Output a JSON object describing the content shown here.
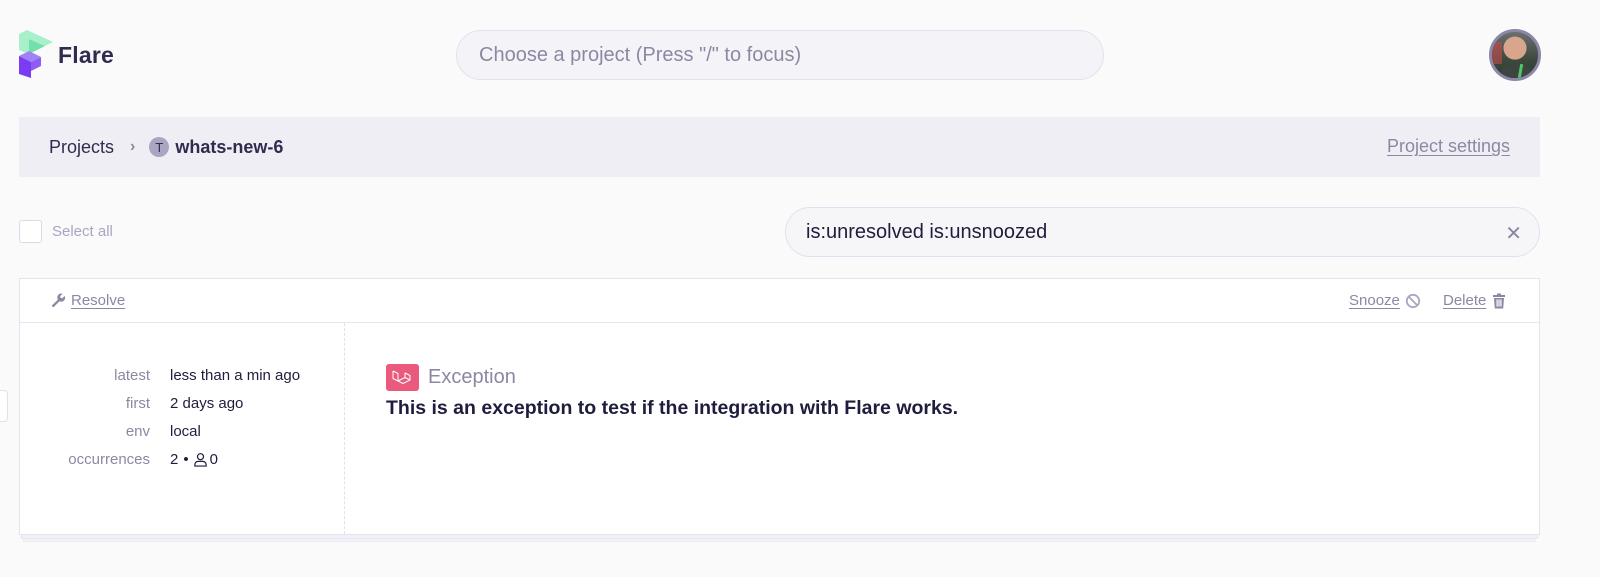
{
  "app": {
    "name": "Flare",
    "brand_colors": {
      "logo_green": "#a6f0cc",
      "logo_purple": "#8e5cf5",
      "error_badge": "#ea5a7d"
    }
  },
  "header": {
    "project_search_placeholder": "Choose a project (Press \"/\" to focus)",
    "avatar_icon": "user-avatar-photo"
  },
  "breadcrumb": {
    "root_label": "Projects",
    "separator_icon": "chevron-right-icon",
    "separator_glyph": "›",
    "project_badge_letter": "T",
    "current_project": "whats-new-6",
    "settings_link": "Project settings"
  },
  "filters": {
    "select_all_label": "Select all",
    "query_value": "is:unresolved is:unsnoozed",
    "clear_glyph": "✕"
  },
  "actions": {
    "resolve_label": "Resolve",
    "snooze_label": "Snooze",
    "delete_label": "Delete"
  },
  "errors": [
    {
      "meta": [
        {
          "key": "latest",
          "value": "less than a min ago"
        },
        {
          "key": "first",
          "value": "2 days ago"
        },
        {
          "key": "env",
          "value": "local"
        }
      ],
      "occurrences_label": "occurrences",
      "occurrences_count": "2",
      "occurrences_separator": "•",
      "affected_users": "0",
      "framework_icon": "laravel-icon",
      "exception_type": "Exception",
      "message": "This is an exception to test if the integration with Flare works."
    }
  ]
}
